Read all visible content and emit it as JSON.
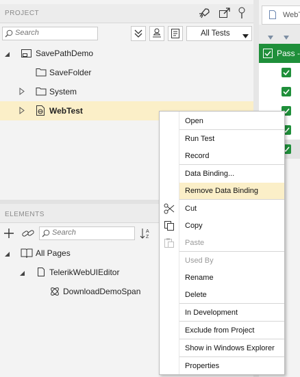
{
  "project_panel": {
    "title": "PROJECT",
    "search_placeholder": "Search",
    "filter_label": "All Tests",
    "tree": [
      {
        "label": "SavePathDemo",
        "icon": "project-icon"
      },
      {
        "label": "SaveFolder",
        "icon": "folder-icon"
      },
      {
        "label": "System",
        "icon": "folder-icon"
      },
      {
        "label": "WebTest",
        "icon": "web-test-icon"
      }
    ]
  },
  "elements_panel": {
    "title": "ELEMENTS",
    "search_placeholder": "Search",
    "tree": [
      {
        "label": "All Pages",
        "icon": "pages-icon"
      },
      {
        "label": "TelerikWebUIEditor",
        "icon": "page-icon"
      },
      {
        "label": "DownloadDemoSpan",
        "icon": "element-icon"
      }
    ]
  },
  "right_panel": {
    "tab_label": "WebT",
    "column_header": "Pass -"
  },
  "context_menu": {
    "open": "Open",
    "run_test": "Run Test",
    "record": "Record",
    "data_binding": "Data Binding...",
    "remove_data_binding": "Remove Data Binding",
    "cut": "Cut",
    "copy": "Copy",
    "paste": "Paste",
    "used_by": "Used By",
    "rename": "Rename",
    "delete": "Delete",
    "in_development": "In Development",
    "exclude_from_project": "Exclude from Project",
    "show_in_explorer": "Show in Windows Explorer",
    "properties": "Properties"
  },
  "colors": {
    "accent_green": "#1f8f3a",
    "highlight": "#fbefc8",
    "panel_header": "#ececec"
  }
}
